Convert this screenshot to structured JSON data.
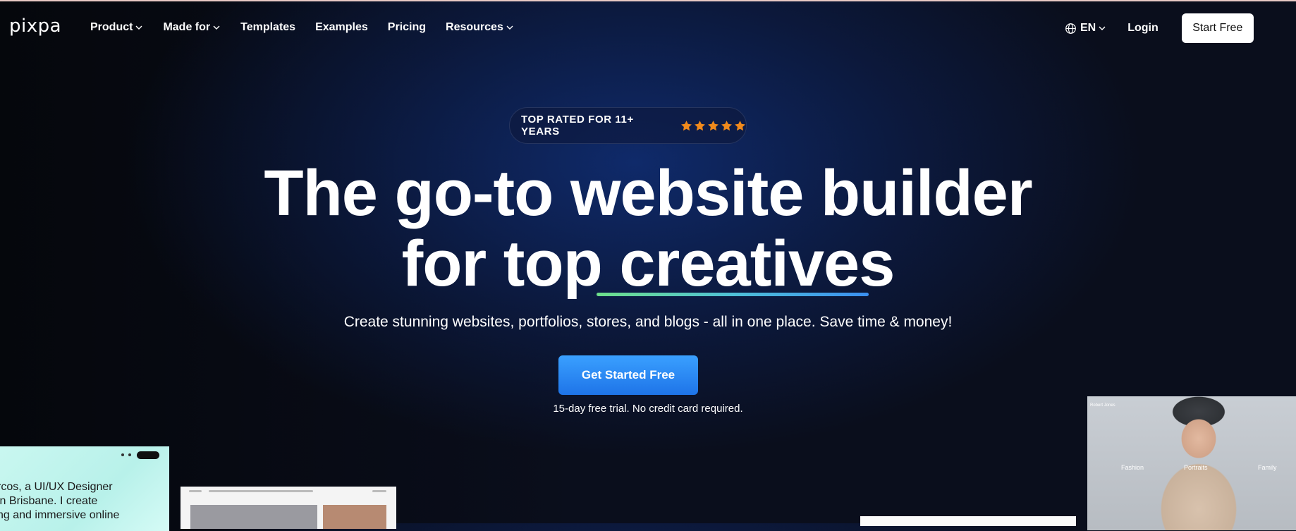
{
  "brand": {
    "logo": "pixpa"
  },
  "nav": {
    "items": [
      {
        "label": "Product",
        "dropdown": true
      },
      {
        "label": "Made for",
        "dropdown": true
      },
      {
        "label": "Templates",
        "dropdown": false
      },
      {
        "label": "Examples",
        "dropdown": false
      },
      {
        "label": "Pricing",
        "dropdown": false
      },
      {
        "label": "Resources",
        "dropdown": true
      }
    ],
    "language": "EN",
    "login": "Login",
    "start": "Start Free"
  },
  "hero": {
    "badge": "TOP RATED FOR 11+ YEARS",
    "rating": 5,
    "headline_line1": "The go-to website builder",
    "headline_line2_prefix": "for top ",
    "headline_line2_emph": "creatives",
    "subtitle": "Create stunning websites, portfolios, stores, and blogs - all in one place. Save time & money!",
    "cta": "Get Started Free",
    "trial_note": "15-day free trial. No credit card required."
  },
  "previews": {
    "card1_text": [
      "rcos, a UI/UX Designer",
      "in Brisbane. I create",
      "ng and immersive online"
    ],
    "card4_brand": "Robert Jones",
    "card4_labels": [
      "Fashion",
      "Portraits",
      "Family"
    ]
  },
  "colors": {
    "accent": "#1e74e8",
    "star": "#f08a1c",
    "underline_start": "#6ee08a",
    "underline_end": "#3a8ff0"
  }
}
